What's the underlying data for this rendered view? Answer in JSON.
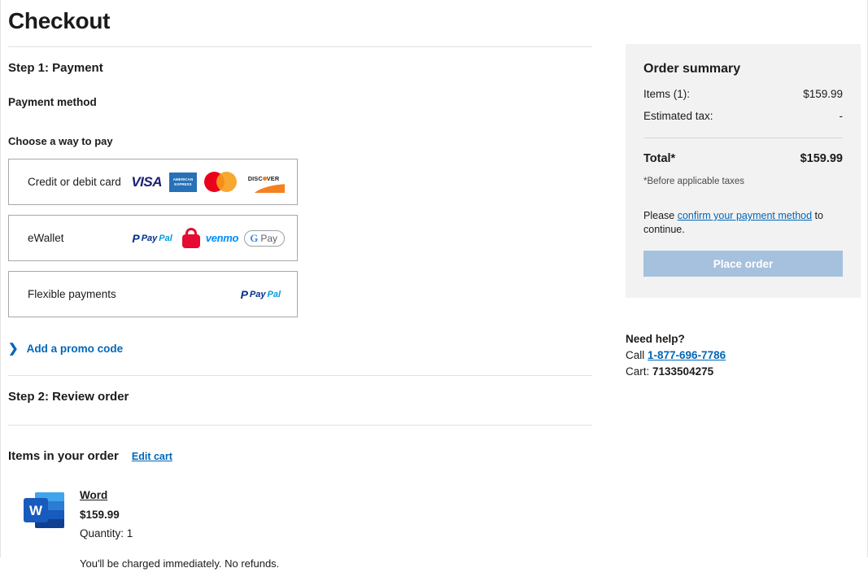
{
  "page": {
    "title": "Checkout"
  },
  "step1": {
    "heading": "Step 1: Payment",
    "payment_method_label": "Payment method",
    "choose_label": "Choose a way to pay",
    "options": [
      {
        "label": "Credit or debit card",
        "logos": [
          "visa-logo",
          "amex-logo",
          "mastercard-logo",
          "discover-logo"
        ],
        "visa_text": "VISA",
        "amex_text": "AMERICAN EXPRESS",
        "discover_text": "DISC VER"
      },
      {
        "label": "eWallet",
        "logos": [
          "paypal-logo",
          "lock-badge-icon",
          "venmo-logo",
          "google-pay-logo"
        ],
        "paypal_mark": "P",
        "paypal_pay": "Pay",
        "paypal_pal": "Pal",
        "venmo_text": "venmo",
        "gpay_g": "G",
        "gpay_pay": "Pay"
      },
      {
        "label": "Flexible payments",
        "logos": [
          "paypal-logo"
        ],
        "paypal_mark": "P",
        "paypal_pay": "Pay",
        "paypal_pal": "Pal"
      }
    ],
    "promo_code_label": "Add a promo code",
    "promo_chevron": "❯"
  },
  "step2": {
    "heading": "Step 2: Review order",
    "items_title": "Items in your order",
    "edit_cart_label": "Edit cart",
    "item": {
      "icon": "microsoft-word-icon",
      "icon_letter": "W",
      "name": "Word",
      "price": "$159.99",
      "quantity": "Quantity: 1",
      "note": "You'll be charged immediately. No refunds."
    }
  },
  "order_summary": {
    "title": "Order summary",
    "rows": [
      {
        "label": "Items (1):",
        "value": "$159.99"
      },
      {
        "label": "Estimated tax:",
        "value": "-"
      }
    ],
    "total_label": "Total*",
    "total_value": "$159.99",
    "footnote": "*Before applicable taxes",
    "confirm_prefix": "Please ",
    "confirm_link": "confirm your payment method",
    "confirm_suffix": " to continue.",
    "place_order_label": "Place order",
    "panel_bg": "#f2f2f2",
    "button_bg": "#a6c1dd"
  },
  "help": {
    "title": "Need help?",
    "call_prefix": "Call ",
    "phone": "1-877-696-7786",
    "cart_prefix": "Cart: ",
    "cart_number": "7133504275"
  }
}
